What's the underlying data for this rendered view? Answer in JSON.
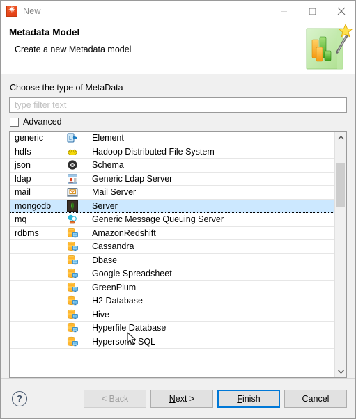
{
  "window": {
    "title": "New",
    "app_icon": "talend-logo-icon",
    "controls": {
      "minimize": "minimize-icon",
      "maximize": "maximize-icon",
      "close": "close-icon"
    }
  },
  "banner": {
    "title": "Metadata Model",
    "subtitle": "Create a new Metadata model",
    "art_icon": "metadata-model-wizard-icon"
  },
  "form": {
    "choose_label": "Choose the type of MetaData",
    "filter": {
      "value": "",
      "placeholder": "type filter text"
    },
    "advanced": {
      "label": "Advanced",
      "checked": false
    }
  },
  "list": {
    "selected_index": 5,
    "rows": [
      {
        "category": "generic",
        "icon": "element-icon",
        "name": "Element"
      },
      {
        "category": "hdfs",
        "icon": "hadoop-icon",
        "name": "Hadoop Distributed File System"
      },
      {
        "category": "json",
        "icon": "json-schema-icon",
        "name": "Schema"
      },
      {
        "category": "ldap",
        "icon": "ldap-server-icon",
        "name": "Generic Ldap Server"
      },
      {
        "category": "mail",
        "icon": "mail-server-icon",
        "name": "Mail Server"
      },
      {
        "category": "mongodb",
        "icon": "mongodb-leaf-icon",
        "name": "Server"
      },
      {
        "category": "mq",
        "icon": "message-queue-icon",
        "name": "Generic Message Queuing Server"
      },
      {
        "category": "rdbms",
        "icon": "database-icon",
        "name": "AmazonRedshift"
      },
      {
        "category": "",
        "icon": "database-icon",
        "name": "Cassandra"
      },
      {
        "category": "",
        "icon": "database-icon",
        "name": "Dbase"
      },
      {
        "category": "",
        "icon": "database-icon",
        "name": "Google Spreadsheet"
      },
      {
        "category": "",
        "icon": "database-icon",
        "name": "GreenPlum"
      },
      {
        "category": "",
        "icon": "database-icon",
        "name": "H2 Database"
      },
      {
        "category": "",
        "icon": "database-icon",
        "name": "Hive"
      },
      {
        "category": "",
        "icon": "database-icon",
        "name": "Hyperfile Database"
      },
      {
        "category": "",
        "icon": "database-icon",
        "name": "Hypersonic SQL"
      }
    ],
    "scrollbar": {
      "up_arrow": "chevron-up-icon",
      "down_arrow": "chevron-down-icon"
    }
  },
  "footer": {
    "help": "?",
    "back": "< Back",
    "next_prefix": "",
    "next_key": "N",
    "next_suffix": "ext >",
    "finish_key": "F",
    "finish_suffix": "inish",
    "cancel": "Cancel"
  },
  "colors": {
    "selection": "#cce8ff",
    "focus_border": "#0078d7",
    "body_bg": "#f0f0f0",
    "brand_red": "#e03c14"
  }
}
